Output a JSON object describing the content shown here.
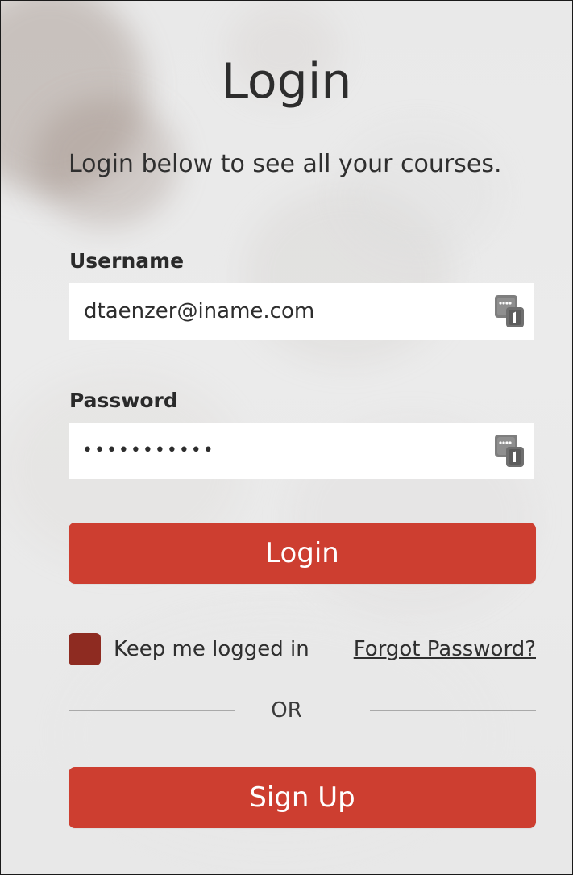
{
  "page": {
    "title": "Login",
    "subtitle": "Login below to see all your courses."
  },
  "form": {
    "username_label": "Username",
    "username_value": "dtaenzer@iname.com",
    "password_label": "Password",
    "password_masked": "•••••••••••",
    "login_button": "Login",
    "keep_logged_in_label": "Keep me logged in",
    "keep_logged_in_checked": true,
    "forgot_password_link": "Forgot Password?",
    "or_label": "OR",
    "signup_button": "Sign Up"
  },
  "icons": {
    "field_badge": "password-manager-key-icon"
  },
  "colors": {
    "primary_button": "#cd3e30",
    "checkbox_fill": "#8e2b21",
    "background": "#eaeaea",
    "text": "#2d2d2d"
  }
}
